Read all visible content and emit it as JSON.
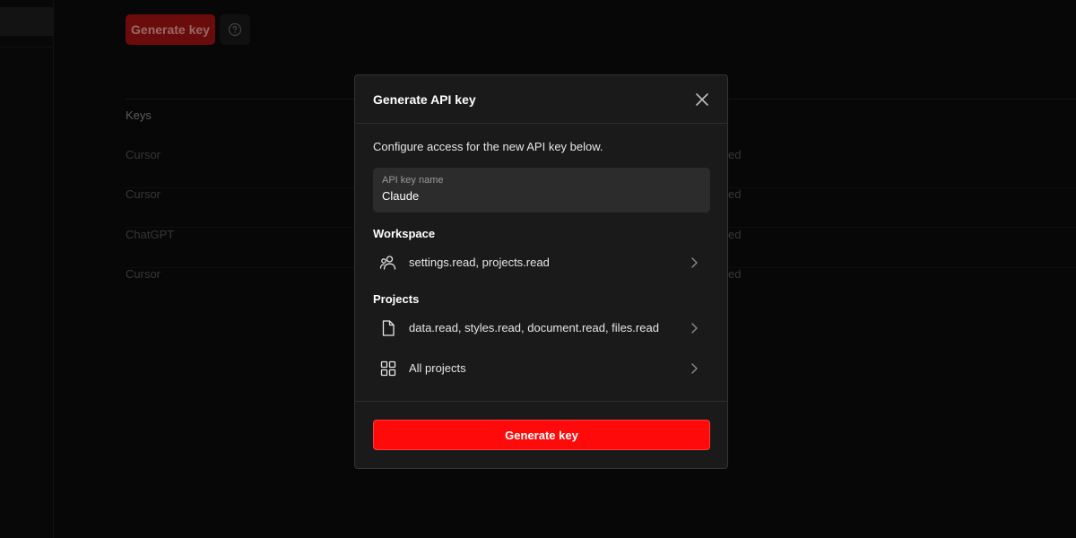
{
  "background": {
    "generate_button_label": "Generate key",
    "help_icon": "question-circle-icon",
    "keys_header": "Keys",
    "rows": [
      {
        "name": "Cursor",
        "status_fragment": "ed"
      },
      {
        "name": "Cursor",
        "status_fragment": "ed"
      },
      {
        "name": "ChatGPT",
        "status_fragment": "ed"
      },
      {
        "name": "Cursor",
        "status_fragment": "ed"
      }
    ]
  },
  "modal": {
    "title": "Generate API key",
    "close_icon": "close-icon",
    "intro": "Configure access for the new API key below.",
    "name_field": {
      "label": "API key name",
      "value": "Claude"
    },
    "workspace": {
      "title": "Workspace",
      "items": [
        {
          "icon": "users-icon",
          "label": "settings.read, projects.read"
        }
      ]
    },
    "projects": {
      "title": "Projects",
      "items": [
        {
          "icon": "document-icon",
          "label": "data.read, styles.read, document.read, files.read"
        },
        {
          "icon": "grid-icon",
          "label": "All projects"
        }
      ]
    },
    "generate_button_label": "Generate key"
  },
  "colors": {
    "accent": "#ff0a0a",
    "modal_bg": "#1a1a1a",
    "page_bg": "#0b0b0b"
  }
}
